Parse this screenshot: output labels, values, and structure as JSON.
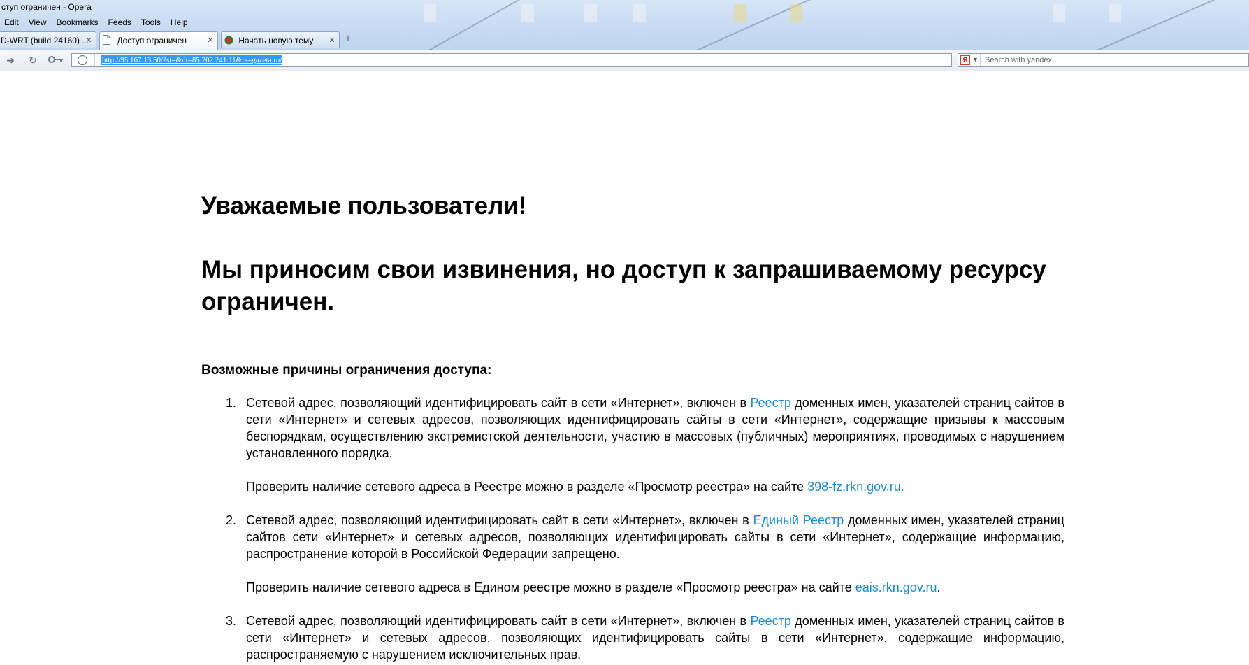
{
  "window": {
    "title": "ступ ограничен - Opera"
  },
  "menu": [
    "Edit",
    "View",
    "Bookmarks",
    "Feeds",
    "Tools",
    "Help"
  ],
  "tabs": [
    {
      "label": "D-WRT (build 24160) ...",
      "active": false
    },
    {
      "label": "Доступ ограничен",
      "active": true
    },
    {
      "label": "Начать новую тему",
      "active": false
    }
  ],
  "address": {
    "url": "http://95.167.13.50/?st=&dt=85.202.241.11&rs=gazeta.ru/"
  },
  "search": {
    "placeholder": "Search with yandex",
    "engine_letter": "Я"
  },
  "page": {
    "greeting": "Уважаемые пользователи!",
    "apology": "Мы приносим свои извинения, но доступ к запрашиваемому ресурсу ограничен.",
    "reasons_heading": "Возможные причины ограничения доступа:",
    "reasons": [
      {
        "num": "1.",
        "text_before": "Сетевой адрес, позволяющий идентифицировать сайт в сети «Интернет», включен в ",
        "link": "Реестр",
        "text_after": " доменных имен, указателей страниц сайтов в сети «Интернет» и сетевых адресов, позволяющих идентифицировать сайты в сети «Интернет», содержащие призывы к массовым беспорядкам, осуществлению экстремистской деятельности, участию в массовых (публичных) мероприятиях, проводимых с нарушением установленного порядка.",
        "check_before": "Проверить наличие сетевого адреса в Реестре можно в разделе «Просмотр реестра» на сайте ",
        "check_link": "398-fz.rkn.gov.ru.",
        "check_after": ""
      },
      {
        "num": "2.",
        "text_before": "Сетевой адрес, позволяющий идентифицировать сайт в сети «Интернет», включен в ",
        "link": "Единый Реестр",
        "text_after": " доменных имен, указателей страниц сайтов сети «Интернет» и сетевых адресов, позволяющих идентифицировать сайты в сети «Интернет», содержащие информацию, распространение которой в Российской Федерации запрещено.",
        "check_before": "Проверить наличие сетевого адреса в Едином реестре можно в разделе «Просмотр реестра» на сайте ",
        "check_link": "eais.rkn.gov.ru",
        "check_after": "."
      },
      {
        "num": "3.",
        "text_before": "Сетевой адрес, позволяющий идентифицировать сайт в сети «Интернет», включен в ",
        "link": "Реестр",
        "text_after": " доменных имен, указателей страниц сайтов в сети «Интернет» и сетевых адресов, позволяющих идентифицировать сайты в сети «Интернет», содержащие информацию, распространяемую с нарушением исключительных прав."
      }
    ]
  },
  "colors": {
    "link": "#1e8bd3",
    "url_highlight": "#3399ff"
  }
}
